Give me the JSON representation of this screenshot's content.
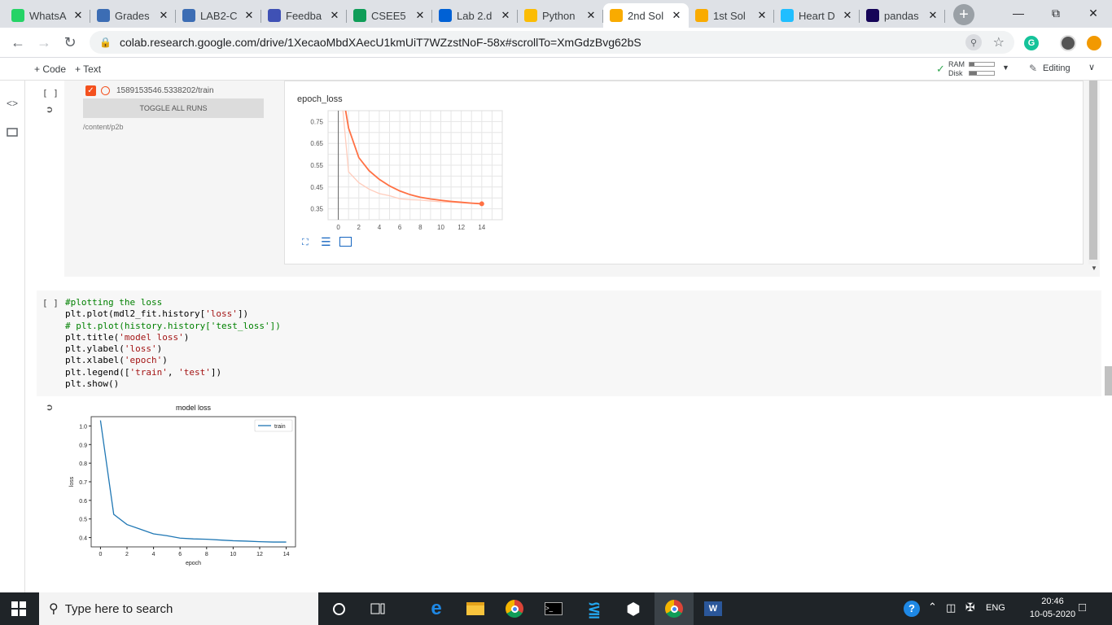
{
  "browser": {
    "tabs": [
      {
        "title": "WhatsA",
        "icon": "whatsapp-icon",
        "color": "#25d366"
      },
      {
        "title": "Grades",
        "icon": "moodle-icon",
        "color": "#3c6db4"
      },
      {
        "title": "LAB2-C",
        "icon": "moodle-icon",
        "color": "#3c6db4"
      },
      {
        "title": "Feedba",
        "icon": "feedback-icon",
        "color": "#3f51b5"
      },
      {
        "title": "CSEE5",
        "icon": "sheets-icon",
        "color": "#0f9d58"
      },
      {
        "title": "Lab 2.d",
        "icon": "box-icon",
        "color": "#0061d5"
      },
      {
        "title": "Python",
        "icon": "drive-icon",
        "color": "#fbbc04"
      },
      {
        "title": "2nd Sol",
        "icon": "colab-icon",
        "color": "#f9ab00",
        "active": true
      },
      {
        "title": "1st Sol",
        "icon": "colab-icon",
        "color": "#f9ab00"
      },
      {
        "title": "Heart D",
        "icon": "kaggle-icon",
        "color": "#20beff"
      },
      {
        "title": "pandas",
        "icon": "pandas-icon",
        "color": "#150458"
      }
    ],
    "url": "colab.research.google.com/drive/1XecaoMbdXAecU1kmUiT7WZzstNoF-58x#scrollTo=XmGdzBvg62bS"
  },
  "colab": {
    "code_btn": "+ Code",
    "text_btn": "+ Text",
    "ram_label": "RAM",
    "disk_label": "Disk",
    "editing_label": "Editing"
  },
  "tensorboard": {
    "cell_marker": "[ ]",
    "run_name": "1589153546.5338202/train",
    "toggle_label": "TOGGLE ALL RUNS",
    "logdir": "/content/p2b",
    "chart_title": "epoch_loss"
  },
  "code_cell": {
    "marker": "[ ]",
    "lines": [
      {
        "kind": "comment",
        "text": "#plotting the loss"
      },
      {
        "kind": "code",
        "text": "plt.plot(mdl2_fit.history['loss'])"
      },
      {
        "kind": "comment",
        "text": "# plt.plot(history.history['test_loss'])"
      },
      {
        "kind": "code",
        "text": "plt.title('model loss')"
      },
      {
        "kind": "code",
        "text": "plt.ylabel('loss')"
      },
      {
        "kind": "code",
        "text": "plt.xlabel('epoch')"
      },
      {
        "kind": "code",
        "text": "plt.legend(['train', 'test'])"
      },
      {
        "kind": "code",
        "text": "plt.show()"
      }
    ]
  },
  "taskbar": {
    "search_placeholder": "Type here to search",
    "lang": "ENG",
    "time": "20:46",
    "date": "10-05-2020"
  },
  "chart_data": [
    {
      "type": "line",
      "title": "epoch_loss",
      "xlabel": "",
      "ylabel": "",
      "xlim": [
        -1,
        16
      ],
      "ylim": [
        0.3,
        0.8
      ],
      "x_ticks": [
        0,
        2,
        4,
        6,
        8,
        10,
        12,
        14
      ],
      "y_ticks": [
        0.35,
        0.45,
        0.55,
        0.65,
        0.75
      ],
      "series": [
        {
          "color": "#ff7043",
          "x": [
            0,
            1,
            2,
            3,
            4,
            5,
            6,
            7,
            8,
            9,
            10,
            11,
            12,
            13,
            14
          ],
          "y": [
            1.0,
            0.72,
            0.585,
            0.525,
            0.485,
            0.455,
            0.432,
            0.415,
            0.403,
            0.395,
            0.389,
            0.384,
            0.38,
            0.376,
            0.373
          ]
        },
        {
          "color": "#ffccbc",
          "x": [
            0,
            1,
            2,
            3,
            4,
            5,
            6,
            7,
            8,
            9,
            10,
            11,
            12,
            13,
            14
          ],
          "y": [
            1.03,
            0.52,
            0.47,
            0.44,
            0.42,
            0.41,
            0.396,
            0.392,
            0.39,
            0.386,
            0.382,
            0.38,
            0.378,
            0.375,
            0.374
          ]
        }
      ],
      "grid": true
    },
    {
      "type": "line",
      "title": "model loss",
      "xlabel": "epoch",
      "ylabel": "loss",
      "xlim": [
        -0.7,
        14.7
      ],
      "ylim": [
        0.35,
        1.05
      ],
      "x_ticks": [
        0,
        2,
        4,
        6,
        8,
        10,
        12,
        14
      ],
      "y_ticks": [
        0.4,
        0.5,
        0.6,
        0.7,
        0.8,
        0.9,
        1.0
      ],
      "legend_position": "top-right",
      "series": [
        {
          "name": "train",
          "color": "#1f77b4",
          "x": [
            0,
            1,
            2,
            3,
            4,
            5,
            6,
            7,
            8,
            9,
            10,
            11,
            12,
            13,
            14
          ],
          "y": [
            1.03,
            0.525,
            0.47,
            0.445,
            0.42,
            0.41,
            0.397,
            0.393,
            0.391,
            0.387,
            0.383,
            0.381,
            0.378,
            0.376,
            0.376
          ]
        }
      ],
      "grid": false
    }
  ]
}
